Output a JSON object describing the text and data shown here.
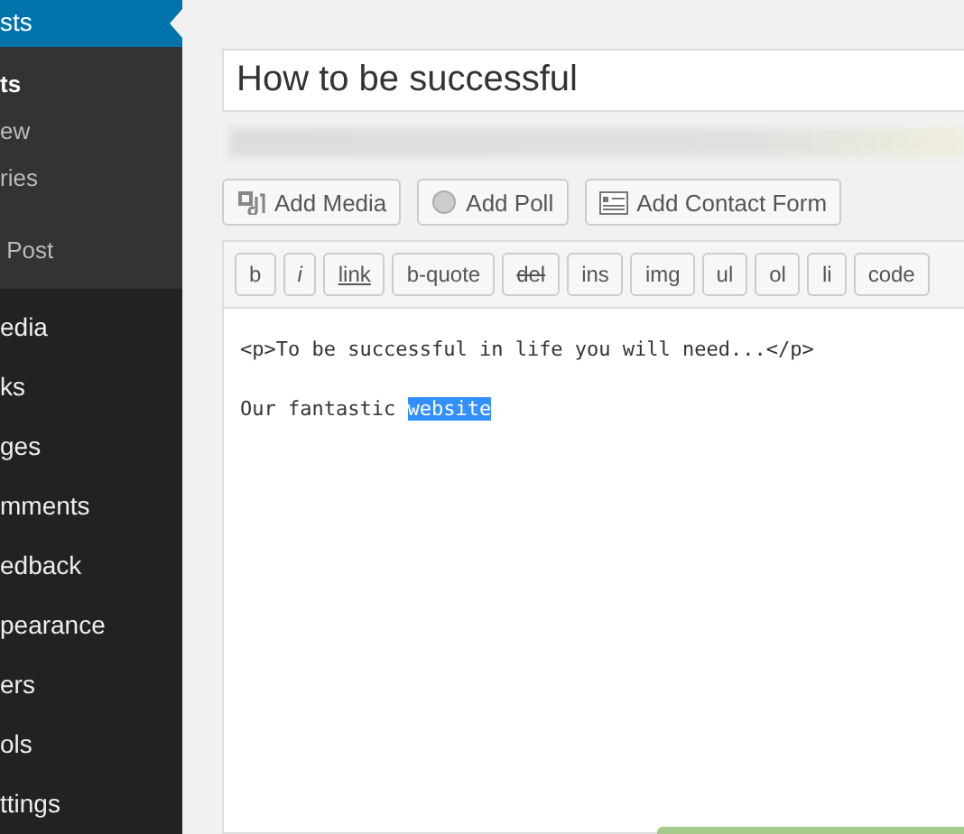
{
  "sidebar": {
    "current": {
      "label": "sts",
      "selected": true
    },
    "submenu": [
      {
        "label": "ts",
        "selected": true
      },
      {
        "label": "ew",
        "selected": false
      },
      {
        "label": "ries",
        "selected": false
      },
      {
        "label": " Post",
        "selected": false
      }
    ],
    "items": [
      {
        "label": "edia"
      },
      {
        "label": "ks"
      },
      {
        "label": "ges"
      },
      {
        "label": "mments"
      },
      {
        "label": "edback"
      },
      {
        "label": "pearance"
      },
      {
        "label": "ers"
      },
      {
        "label": "ols"
      },
      {
        "label": "ttings"
      }
    ]
  },
  "title_field": {
    "value": "How to be successful"
  },
  "media_buttons": [
    {
      "label": "Add Media",
      "kind": "media"
    },
    {
      "label": "Add Poll",
      "kind": "poll"
    },
    {
      "label": "Add Contact Form",
      "kind": "form"
    }
  ],
  "quicktags": [
    {
      "label": "b",
      "kind": "plain"
    },
    {
      "label": "i",
      "kind": "italic"
    },
    {
      "label": "link",
      "kind": "underline"
    },
    {
      "label": "b-quote",
      "kind": "plain"
    },
    {
      "label": "del",
      "kind": "strike"
    },
    {
      "label": "ins",
      "kind": "plain"
    },
    {
      "label": "img",
      "kind": "plain"
    },
    {
      "label": "ul",
      "kind": "plain"
    },
    {
      "label": "ol",
      "kind": "plain"
    },
    {
      "label": "li",
      "kind": "plain"
    },
    {
      "label": "code",
      "kind": "plain"
    }
  ],
  "editor_lines": [
    [
      {
        "text": "<p>To be successful in life you will need...</p>",
        "selected": false
      }
    ],
    [
      {
        "text": "Our fantastic ",
        "selected": false
      },
      {
        "text": "website",
        "selected": true
      }
    ]
  ]
}
